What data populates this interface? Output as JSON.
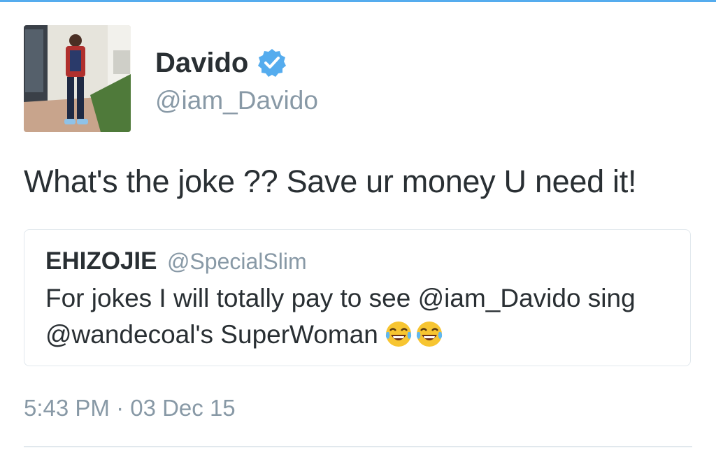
{
  "tweet": {
    "author": {
      "display_name": "Davido",
      "handle": "@iam_Davido",
      "verified": true,
      "avatar_icon": "user-photo"
    },
    "text": "What's the joke ?? Save ur money U need it!",
    "timestamp": "5:43 PM · 03 Dec 15"
  },
  "quoted_tweet": {
    "display_name": "EHIZOJIE",
    "handle": "@SpecialSlim",
    "text": "For jokes I will totally pay to see @iam_Davido sing @wandecoal's SuperWoman",
    "emoji": [
      "face-with-tears-of-joy",
      "face-with-tears-of-joy"
    ]
  },
  "colors": {
    "accent": "#55acee",
    "text": "#292f33",
    "muted": "#8899a6",
    "border": "#e1e8ed"
  }
}
